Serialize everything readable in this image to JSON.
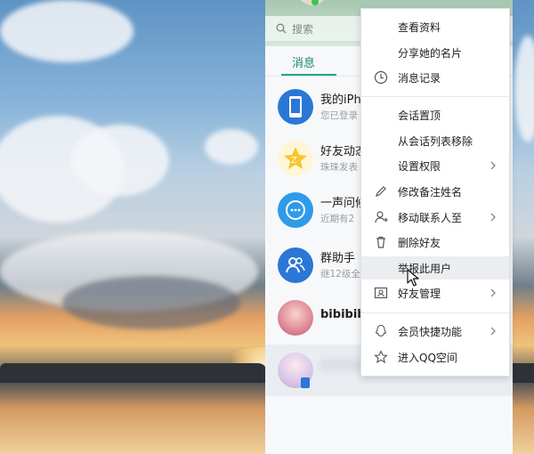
{
  "search": {
    "placeholder": "搜索",
    "icon": "search-icon"
  },
  "tabs": {
    "messages": "消息"
  },
  "chats": [
    {
      "name": "我的iPh",
      "preview": "您已登录",
      "icon": "phone-icon",
      "color": "#2a77d6"
    },
    {
      "name": "好友动态",
      "preview": "珠珠发表",
      "icon": "qzone-star-icon",
      "color": "#f7c52f"
    },
    {
      "name": "一声问候",
      "preview": "近期有2",
      "icon": "chat-bubble-icon",
      "color": "#2f9be8"
    },
    {
      "name": "群助手",
      "preview": "继12级全",
      "icon": "group-icon",
      "color": "#2a77d6"
    },
    {
      "name": "bibibibi",
      "preview": "",
      "icon": "avatar-photo",
      "color": "#e28c9c"
    },
    {
      "name": "",
      "preview": "",
      "icon": "avatar-photo",
      "color": "#d9c6e7"
    }
  ],
  "menu": {
    "view_profile": "查看资料",
    "share_card": "分享她的名片",
    "message_history": "消息记录",
    "pin_chat": "会话置顶",
    "remove_from_list": "从会话列表移除",
    "set_permissions": "设置权限",
    "edit_remark": "修改备注姓名",
    "move_contact": "移动联系人至",
    "delete_friend": "删除好友",
    "report_user": "举报此用户",
    "friend_management": "好友管理",
    "vip_shortcuts": "会员快捷功能",
    "enter_qzone": "进入QQ空间"
  },
  "colors": {
    "accent": "#24a57f",
    "menu_hover": "#ebedf0",
    "online": "#37c84f"
  }
}
